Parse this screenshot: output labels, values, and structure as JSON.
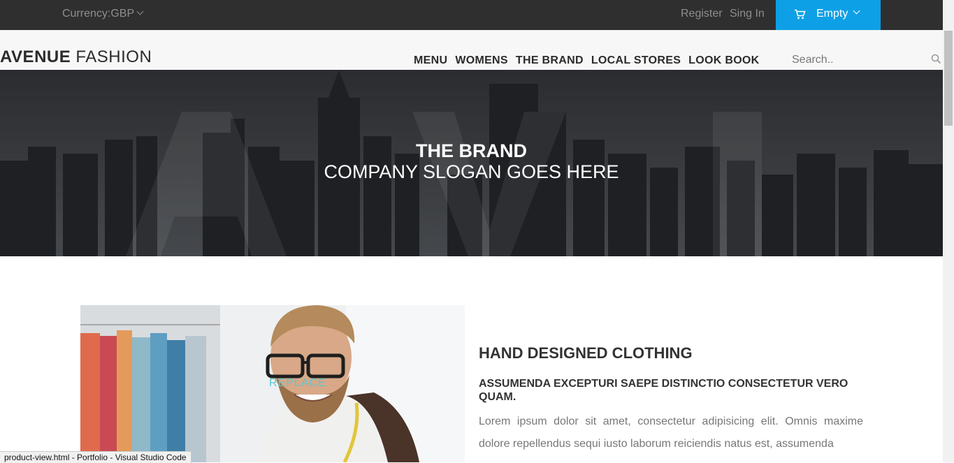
{
  "topbar": {
    "currency": "Currency:GBP",
    "register": "Register",
    "signin": "Sing In",
    "cart_label": "Empty"
  },
  "header": {
    "logo_bold": "AVENUE",
    "logo_light": "FASHION",
    "nav": [
      "MENU",
      "WOMENS",
      "THE BRAND",
      "LOCAL STORES",
      "LOOK BOOK"
    ],
    "search_placeholder": "Search.."
  },
  "hero": {
    "title": "THE BRAND",
    "slogan": "COMPANY SLOGAN GOES HERE"
  },
  "content": {
    "image_overlay": "REPLACE",
    "heading": "HAND DESIGNED CLOTHING",
    "subheading": "ASSUMENDA EXCEPTURI SAEPE DISTINCTIO CONSECTETUR VERO QUAM.",
    "paragraph": "Lorem ipsum dolor sit amet, consectetur adipisicing elit. Omnis maxime dolore repellendus sequi iusto laborum reiciendis natus est, assumenda"
  },
  "statusbar": {
    "text": "product-view.html - Portfolio - Visual Studio Code"
  },
  "colors": {
    "topbar": "#2f2f2f",
    "cart_accent": "#0ea0e6",
    "hero_overlay": "#2e3033"
  }
}
